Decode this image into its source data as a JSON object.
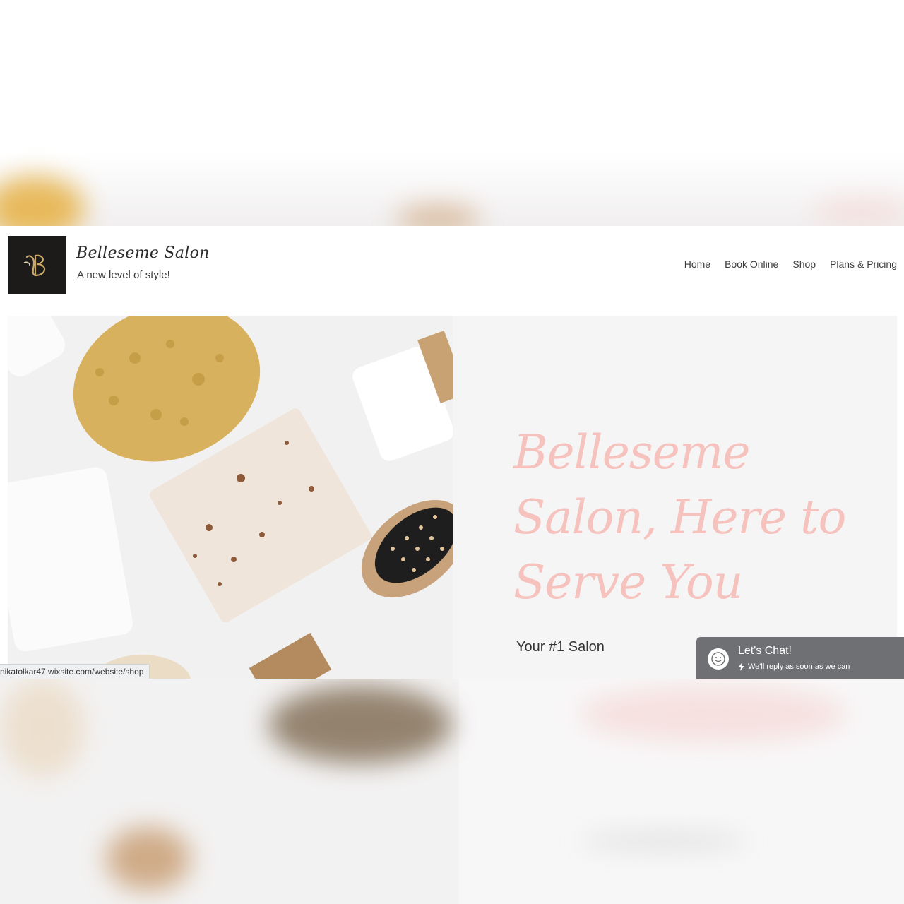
{
  "site": {
    "title": "Belleseme Salon",
    "tagline": "A new level of style!"
  },
  "nav": {
    "items": [
      {
        "label": "Home"
      },
      {
        "label": "Book Online"
      },
      {
        "label": "Shop"
      },
      {
        "label": "Plans & Pricing"
      }
    ]
  },
  "hero": {
    "title": "Belleseme Salon, Here to Serve You",
    "subtitle": "Your #1 Salon",
    "title_color": "#f5c2bd"
  },
  "chat": {
    "title": "Let's Chat!",
    "subtitle": "We'll reply as soon as we can",
    "icons": [
      "smiley-icon",
      "lightning-icon"
    ]
  },
  "status_bar": {
    "url": "nikatolkar47.wixsite.com/website/shop"
  },
  "colors": {
    "logo_bg": "#1d1a1a",
    "logo_gold": "#c9a86a",
    "chat_bg": "#6f7073"
  }
}
